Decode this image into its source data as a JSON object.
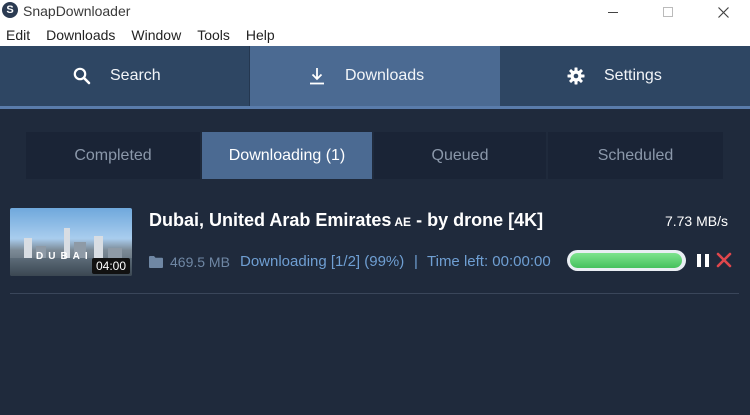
{
  "window": {
    "title": "SnapDownloader",
    "logo_letter": "S"
  },
  "menu": [
    "Edit",
    "Downloads",
    "Window",
    "Tools",
    "Help"
  ],
  "main_tabs": {
    "search": {
      "label": "Search",
      "icon": "search-icon"
    },
    "downloads": {
      "label": "Downloads",
      "icon": "download-icon",
      "active": true
    },
    "settings": {
      "label": "Settings",
      "icon": "gear-icon"
    }
  },
  "sub_tabs": {
    "completed": "Completed",
    "downloading": "Downloading (1)",
    "queued": "Queued",
    "scheduled": "Scheduled",
    "active": "downloading"
  },
  "download": {
    "title": "Dubai, United Arab Emirates",
    "flag_code": "AE",
    "title_suffix": "- by drone [4K]",
    "speed": "7.73 MB/s",
    "thumbnail_text": "DUBAI",
    "duration": "04:00",
    "size": "469.5 MB",
    "status": "Downloading [1/2] (99%)",
    "separator": "|",
    "time_left": "Time left: 00:00:00",
    "progress": 0.99
  },
  "colors": {
    "background": "#1f2a3c",
    "tab_bar": "#2e4663",
    "active_tab": "#4b6a92",
    "status_text": "#6f9fd3",
    "progress_fill": "#45c15d",
    "cancel": "#e0474c"
  }
}
